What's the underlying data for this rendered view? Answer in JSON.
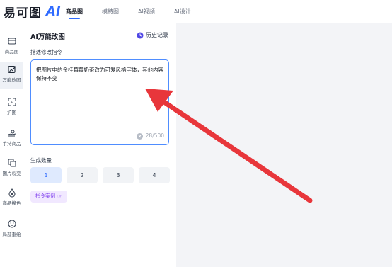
{
  "logo": {
    "text": "易可图",
    "ai": "Ai"
  },
  "nav": {
    "tabs": [
      {
        "label": "商品图",
        "active": true
      },
      {
        "label": "模特图",
        "active": false
      },
      {
        "label": "AI视频",
        "active": false
      },
      {
        "label": "AI设计",
        "active": false
      }
    ]
  },
  "sidebar": {
    "items": [
      {
        "label": "商品图",
        "icon": "image-frame-icon",
        "active": false
      },
      {
        "label": "万能改图",
        "icon": "edit-image-icon",
        "active": true
      },
      {
        "label": "扩图",
        "icon": "expand-image-icon",
        "active": false
      },
      {
        "label": "手持商品",
        "icon": "hand-hold-icon",
        "active": false
      },
      {
        "label": "图片裂变",
        "icon": "image-variation-icon",
        "active": false
      },
      {
        "label": "商品换色",
        "icon": "color-swap-icon",
        "active": false
      },
      {
        "label": "局部重绘",
        "icon": "face-redraw-icon",
        "active": false
      }
    ]
  },
  "panel": {
    "title": "AI万能改图",
    "history_label": "历史记录",
    "instruction_label": "描述修改指令",
    "instruction_value": "把图片中的金桂莓莓奶茶改为可爱风格字体，其他内容保持不变",
    "char_count": "28/500",
    "quantity_label": "生成数量",
    "quantities": [
      "1",
      "2",
      "3",
      "4"
    ],
    "selected_quantity": "1",
    "example_label": "指令案例"
  },
  "colors": {
    "accent": "#2f6bff",
    "annotation_arrow": "#e8363b",
    "canvas_bg": "#f3f4f7"
  }
}
